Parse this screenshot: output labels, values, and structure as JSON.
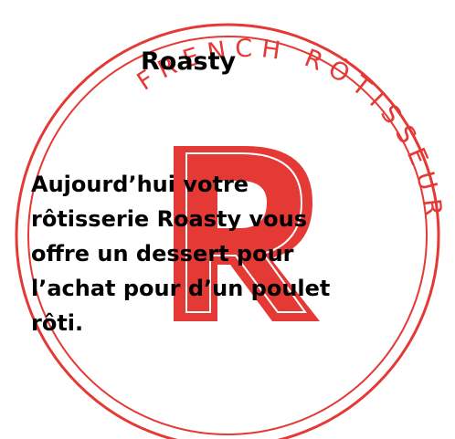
{
  "brand": {
    "title": "Roasty"
  },
  "logo": {
    "ring_text": "FRENCH RÔTISSEUR",
    "monogram": "R",
    "accent_color": "#e53935"
  },
  "promo": {
    "message": "Aujourd’hui votre rôtisserie Roasty vous offre un dessert pour l’achat pour d’un poulet rôti."
  }
}
